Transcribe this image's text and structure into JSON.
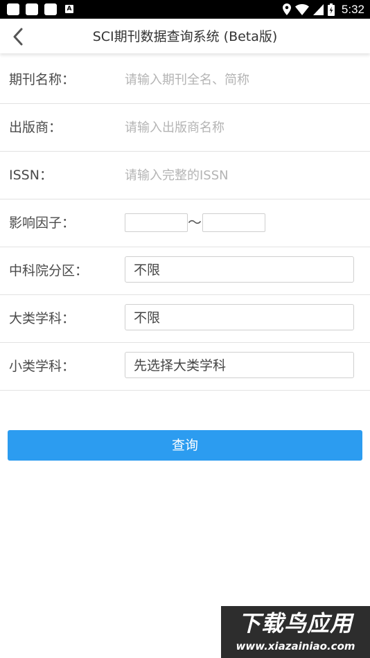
{
  "status_bar": {
    "a_icon_label": "A",
    "time": "5:32",
    "icons": [
      "notification-icon",
      "notification-icon",
      "notification-icon",
      "a-icon",
      "location-icon",
      "wifi-icon",
      "signal-icon",
      "battery-icon"
    ]
  },
  "app_bar": {
    "back_icon": "chevron-left-icon",
    "title": "SCI期刊数据查询系统 (Beta版)"
  },
  "form": {
    "journal_name": {
      "label": "期刊名称：",
      "placeholder": "请输入期刊全名、简称",
      "value": ""
    },
    "publisher": {
      "label": "出版商：",
      "placeholder": "请输入出版商名称",
      "value": ""
    },
    "issn": {
      "label": "ISSN：",
      "placeholder": "请输入完整的ISSN",
      "value": ""
    },
    "impact_factor": {
      "label": "影响因子：",
      "separator": "〜",
      "min_value": "",
      "max_value": ""
    },
    "cas_zone": {
      "label": "中科院分区：",
      "selected": "不限"
    },
    "major_subject": {
      "label": "大类学科：",
      "selected": "不限"
    },
    "minor_subject": {
      "label": "小类学科：",
      "selected": "先选择大类学科"
    }
  },
  "submit": {
    "label": "查询",
    "color": "#2c9cf0"
  },
  "watermark": {
    "main_text": "下载鸟应用",
    "url_text": "www.xiazainiao.com"
  }
}
